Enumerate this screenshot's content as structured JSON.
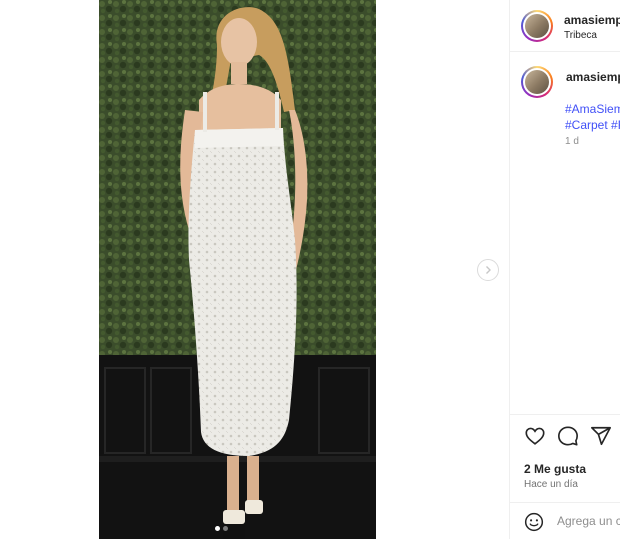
{
  "post": {
    "username": "amasiempre",
    "location": "Tribeca"
  },
  "caption": {
    "username": "amasiempre",
    "hashtags": [
      "#AmaSiempre",
      "#Carpet #RedCarpet"
    ],
    "time": "1 d"
  },
  "media": {
    "carousel_count": 2,
    "carousel_active_index": 0
  },
  "actions": {
    "likes": "2 Me gusta",
    "posted_ago": "Hace un día"
  },
  "comment_box": {
    "placeholder": "Agrega un comentario..."
  },
  "icons": {
    "like": "heart-icon",
    "comment": "comment-icon",
    "share": "share-icon",
    "emoji": "emoji-icon",
    "next": "chevron-right-icon"
  },
  "colors": {
    "hashtag": "#4150f7",
    "muted": "#8e8e8e",
    "border": "#efefef"
  }
}
